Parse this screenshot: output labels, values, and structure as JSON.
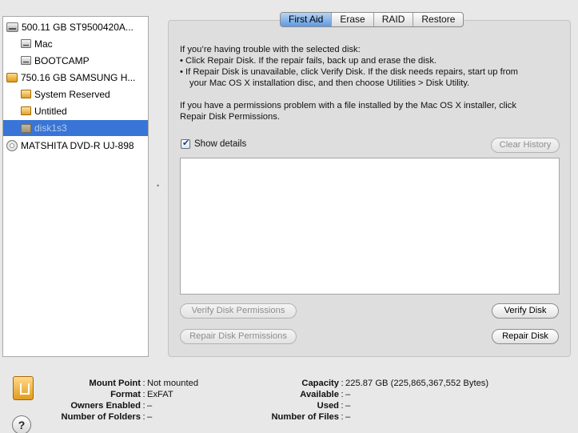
{
  "sidebar": {
    "items": [
      {
        "label": "500.11 GB ST9500420A...",
        "icon": "internal-disk-icon",
        "level": 0
      },
      {
        "label": "Mac",
        "icon": "volume-icon",
        "level": 1
      },
      {
        "label": "BOOTCAMP",
        "icon": "volume-icon",
        "level": 1
      },
      {
        "label": "750.16 GB SAMSUNG H...",
        "icon": "external-disk-icon",
        "level": 0
      },
      {
        "label": "System Reserved",
        "icon": "external-volume-icon",
        "level": 1
      },
      {
        "label": "Untitled",
        "icon": "external-volume-icon",
        "level": 1
      },
      {
        "label": "disk1s3",
        "icon": "external-volume-icon",
        "level": 1,
        "selected": true
      },
      {
        "label": "MATSHITA DVD-R UJ-898",
        "icon": "dvd-drive-icon",
        "level": 0
      }
    ]
  },
  "tabs": [
    "First Aid",
    "Erase",
    "RAID",
    "Restore"
  ],
  "active_tab": "First Aid",
  "first_aid": {
    "intro": "If you’re having trouble with the selected disk:",
    "bullet1": "• Click Repair Disk. If the repair fails, back up and erase the disk.",
    "bullet2a": "• If Repair Disk is unavailable, click Verify Disk. If the disk needs repairs, start up from",
    "bullet2b": "your Mac OS X installation disc, and then choose Utilities > Disk Utility.",
    "perm1": "If you have a permissions problem with a file installed by the Mac OS X installer, click",
    "perm2": "Repair Disk Permissions.",
    "show_details_label": "Show details",
    "show_details_checked": true,
    "clear_history_label": "Clear History",
    "verify_permissions_label": "Verify Disk Permissions",
    "repair_permissions_label": "Repair Disk Permissions",
    "verify_disk_label": "Verify Disk",
    "repair_disk_label": "Repair Disk"
  },
  "info": {
    "mount_point_key": "Mount Point",
    "mount_point": "Not mounted",
    "format_key": "Format",
    "format": "ExFAT",
    "owners_key": "Owners Enabled",
    "owners": "–",
    "folders_key": "Number of Folders",
    "folders": "–",
    "capacity_key": "Capacity",
    "capacity": "225.87 GB (225,865,367,552 Bytes)",
    "available_key": "Available",
    "available": "–",
    "used_key": "Used",
    "used": "–",
    "files_key": "Number of Files",
    "files": "–"
  },
  "help_label": "?"
}
